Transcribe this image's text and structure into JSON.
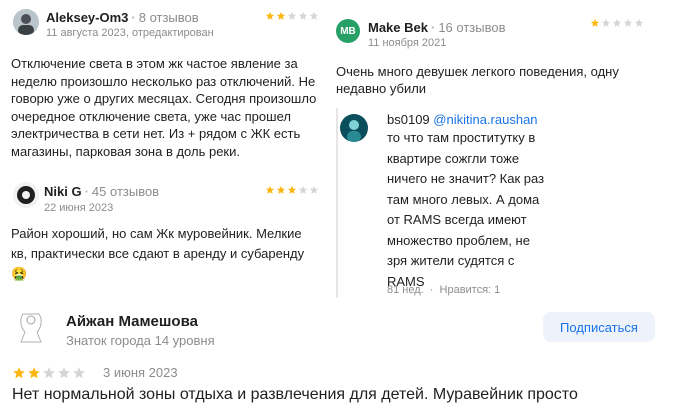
{
  "reviews": [
    {
      "author": "Aleksey-Om3",
      "reviews_count": "8 отзывов",
      "date": "11 августа 2023, отредактирован",
      "rating": 2,
      "text": "Отключение света в этом жк частое явление за неделю произошло несколько раз отключений. Не говорю уже о других месяцах. Сегодня произошло очередное отключение света, уже час прошел электричества в сети нет. Из + рядом с ЖК есть магазины, парковая зона в доль реки."
    },
    {
      "author": "Niki G",
      "reviews_count": "45 отзывов",
      "date": "22 июня 2023",
      "rating": 3,
      "text": "Район хороший, но сам Жк муровейник. Мелкие кв, практически все сдают в аренду и субаренду 🤮"
    },
    {
      "author": "Make Bek",
      "avatar_initials": "MB",
      "reviews_count": "16 отзывов",
      "date": "11 ноября 2021",
      "rating": 1,
      "text": "Очень много девушек легкого поведения, одну недавно убили"
    }
  ],
  "reply": {
    "author": "bs0109",
    "mention": "@nikitina.raushan",
    "text": "то что там проститутку в квартире сожгли тоже ничего не значит? Как раз там много левых. А дома от RAMS всегда имеют множество проблем, не зря жители судятся с RAMS",
    "age": "81 нед.",
    "likes": "Нравится: 1"
  },
  "featured": {
    "author": "Айжан Мамешова",
    "subtitle": "Знаток города 14 уровня",
    "subscribe_label": "Подписаться",
    "rating": 2,
    "date": "3 июня 2023",
    "text": "Нет нормальной зоны отдыха и развлечения для детей. Муравейник просто"
  },
  "colors": {
    "star_filled": "#fdb713",
    "star_empty": "#d6d6d6",
    "avatar_mb": "#27a067",
    "link": "#1a73e8",
    "button_bg": "#eef3fb"
  }
}
